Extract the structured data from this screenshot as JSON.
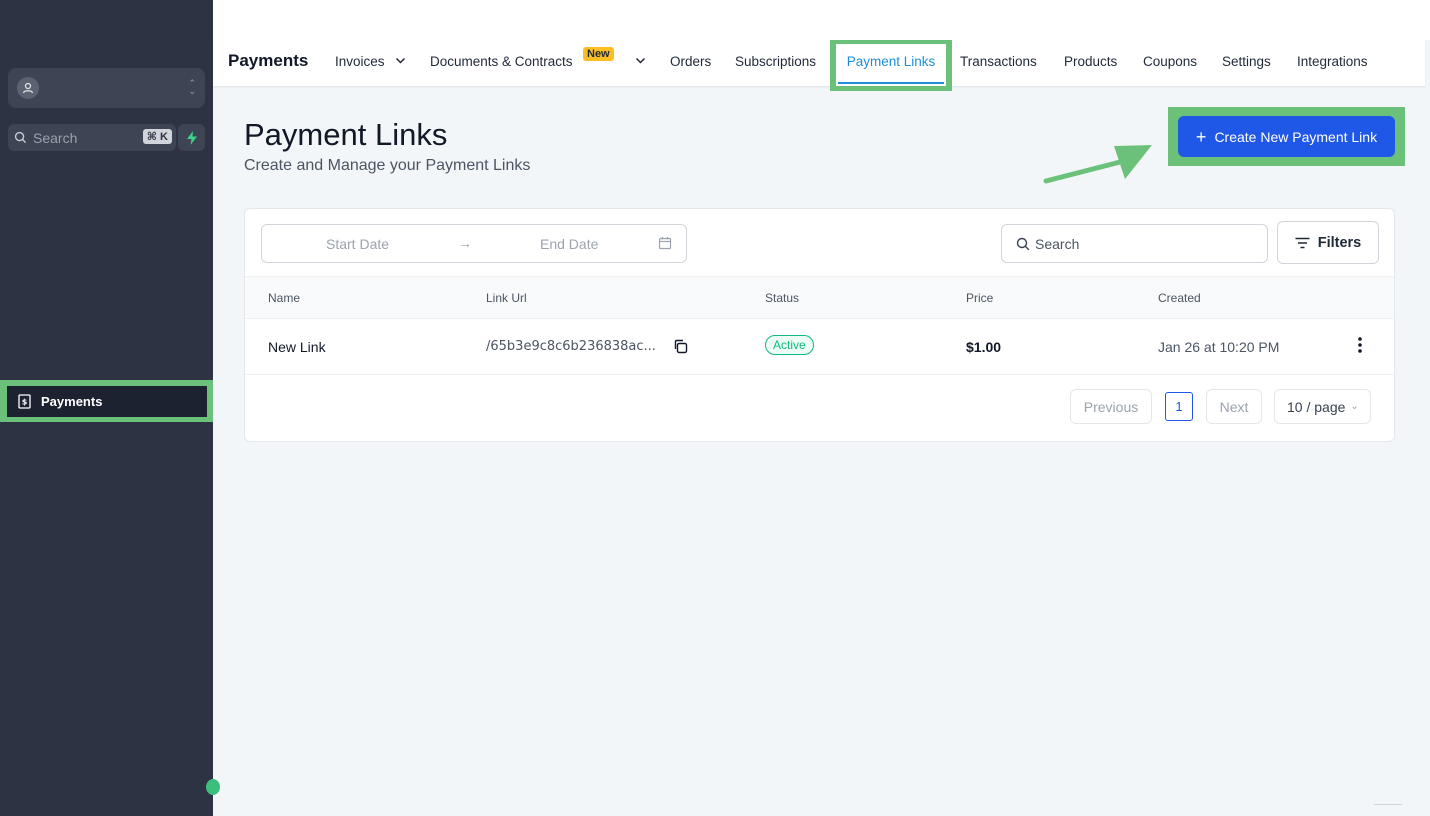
{
  "sidebar": {
    "search_label": "Search",
    "search_shortcut": "⌘ K",
    "nav_items": [
      {
        "label": "Payments",
        "icon": "receipt-dollar-icon",
        "active": true
      }
    ]
  },
  "header": {
    "app_title": "Payments",
    "tabs": [
      {
        "label": "Invoices",
        "has_dropdown": true
      },
      {
        "label": "Documents & Contracts",
        "badge": "New",
        "has_dropdown": true
      },
      {
        "label": "Orders"
      },
      {
        "label": "Subscriptions"
      },
      {
        "label": "Payment Links",
        "active": true
      },
      {
        "label": "Transactions"
      },
      {
        "label": "Products"
      },
      {
        "label": "Coupons"
      },
      {
        "label": "Settings"
      },
      {
        "label": "Integrations"
      }
    ]
  },
  "page": {
    "title": "Payment Links",
    "subtitle": "Create and Manage your Payment Links",
    "create_button": "Create New Payment Link"
  },
  "filters": {
    "start_date_placeholder": "Start Date",
    "end_date_placeholder": "End Date",
    "search_placeholder": "Search",
    "filters_button": "Filters"
  },
  "table": {
    "columns": [
      "Name",
      "Link Url",
      "Status",
      "Price",
      "Created"
    ],
    "rows": [
      {
        "name": "New Link",
        "link_url": "/65b3e9c8c6b236838ac...",
        "status": "Active",
        "price": "$1.00",
        "created": "Jan 26 at 10:20 PM"
      }
    ]
  },
  "pagination": {
    "previous": "Previous",
    "current_page": "1",
    "next": "Next",
    "per_page": "10 / page"
  },
  "colors": {
    "accent_blue": "#1f57e6",
    "highlight_green": "#6cc17a",
    "sidebar_bg": "#2d3342",
    "active_tab": "#1d8fd8",
    "status_active": "#10b981"
  }
}
